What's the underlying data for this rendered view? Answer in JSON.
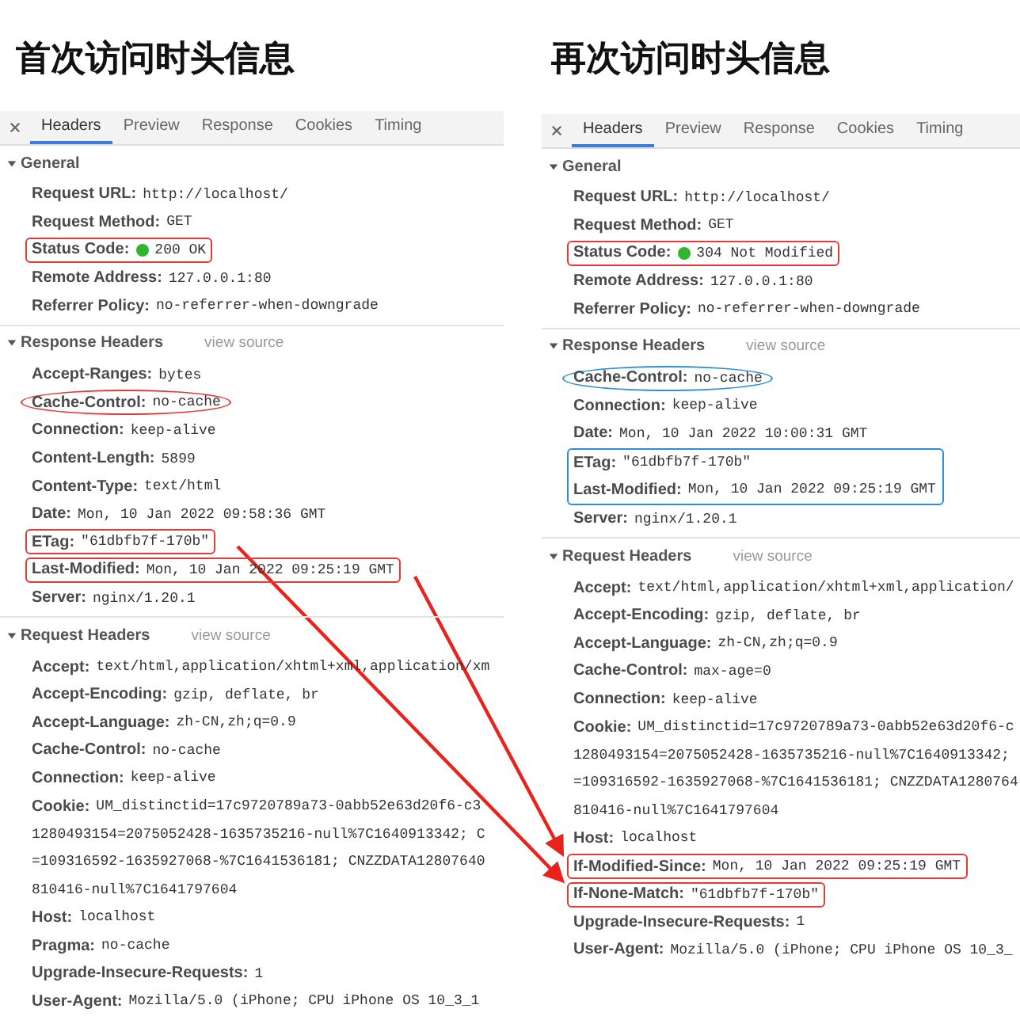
{
  "panels": [
    {
      "title": "首次访问时头信息",
      "tabs": [
        {
          "label": "Headers",
          "selected": true
        },
        {
          "label": "Preview",
          "selected": false
        },
        {
          "label": "Response",
          "selected": false
        },
        {
          "label": "Cookies",
          "selected": false
        },
        {
          "label": "Timing",
          "selected": false
        }
      ],
      "sections": [
        {
          "title": "General",
          "expanded": true,
          "rows": [
            {
              "label": "Request URL:",
              "value": "http://localhost/"
            },
            {
              "label": "Request Method:",
              "value": "GET"
            },
            {
              "label": "Status Code:",
              "value": "200 OK",
              "color": "#2fb52f",
              "mark": {
                "kind": "box",
                "color": "#e53935"
              }
            },
            {
              "label": "Remote Address:",
              "value": "127.0.0.1:80"
            },
            {
              "label": "Referrer Policy:",
              "value": "no-referrer-when-downgrade"
            }
          ]
        },
        {
          "title": "Response Headers",
          "link": "view source",
          "expanded": true,
          "rows": [
            {
              "label": "Accept-Ranges:",
              "value": "bytes"
            },
            {
              "label": "Cache-Control:",
              "value": "no-cache",
              "mark": {
                "kind": "ellipse",
                "color": "#e53935"
              }
            },
            {
              "label": "Connection:",
              "value": "keep-alive"
            },
            {
              "label": "Content-Length:",
              "value": "5899"
            },
            {
              "label": "Content-Type:",
              "value": "text/html"
            },
            {
              "label": "Date:",
              "value": "Mon, 10 Jan 2022 09:58:36 GMT"
            },
            {
              "label": "ETag:",
              "value": "\"61dbfb7f-170b\"",
              "mark": {
                "kind": "box",
                "color": "#e53935"
              }
            },
            {
              "label": "Last-Modified:",
              "value": "Mon, 10 Jan 2022 09:25:19 GMT",
              "mark": {
                "kind": "box",
                "color": "#e53935"
              }
            },
            {
              "label": "Server:",
              "value": "nginx/1.20.1"
            }
          ]
        },
        {
          "title": "Request Headers",
          "link": "view source",
          "expanded": true,
          "rows": [
            {
              "label": "Accept:",
              "value": "text/html,application/xhtml+xml,application/xm"
            },
            {
              "label": "Accept-Encoding:",
              "value": "gzip, deflate, br"
            },
            {
              "label": "Accept-Language:",
              "value": "zh-CN,zh;q=0.9"
            },
            {
              "label": "Cache-Control:",
              "value": "no-cache"
            },
            {
              "label": "Connection:",
              "value": "keep-alive"
            },
            {
              "label": "Cookie:",
              "value": "UM_distinctid=17c9720789a73-0abb52e63d20f6-c3",
              "continuation": [
                "1280493154=2075052428-1635735216-null%7C1640913342; C",
                "=109316592-1635927068-%7C1641536181; CNZZDATA12807640",
                "810416-null%7C1641797604"
              ]
            },
            {
              "label": "Host:",
              "value": "localhost"
            },
            {
              "label": "Pragma:",
              "value": "no-cache"
            },
            {
              "label": "Upgrade-Insecure-Requests:",
              "value": "1"
            },
            {
              "label": "User-Agent:",
              "value": "Mozilla/5.0 (iPhone; CPU iPhone OS 10_3_1"
            }
          ]
        }
      ]
    },
    {
      "title": "再次访问时头信息",
      "tabs": [
        {
          "label": "Headers",
          "selected": true
        },
        {
          "label": "Preview",
          "selected": false
        },
        {
          "label": "Response",
          "selected": false
        },
        {
          "label": "Cookies",
          "selected": false
        },
        {
          "label": "Timing",
          "selected": false
        }
      ],
      "sections": [
        {
          "title": "General",
          "expanded": true,
          "rows": [
            {
              "label": "Request URL:",
              "value": "http://localhost/"
            },
            {
              "label": "Request Method:",
              "value": "GET"
            },
            {
              "label": "Status Code:",
              "value": "304 Not Modified",
              "color": "#2fb52f",
              "mark": {
                "kind": "box",
                "color": "#e53935"
              }
            },
            {
              "label": "Remote Address:",
              "value": "127.0.0.1:80"
            },
            {
              "label": "Referrer Policy:",
              "value": "no-referrer-when-downgrade"
            }
          ]
        },
        {
          "title": "Response Headers",
          "link": "view source",
          "expanded": true,
          "rows": [
            {
              "label": "Cache-Control:",
              "value": "no-cache",
              "mark": {
                "kind": "ellipse",
                "color": "#2a8fd8"
              }
            },
            {
              "label": "Connection:",
              "value": "keep-alive"
            },
            {
              "label": "Date:",
              "value": "Mon, 10 Jan 2022 10:00:31 GMT"
            },
            {
              "kind": "group",
              "mark": {
                "kind": "box",
                "color": "#2a8fd8"
              },
              "rows": [
                {
                  "label": "ETag:",
                  "value": "\"61dbfb7f-170b\""
                },
                {
                  "label": "Last-Modified:",
                  "value": "Mon, 10 Jan 2022 09:25:19 GMT"
                }
              ]
            },
            {
              "label": "Server:",
              "value": "nginx/1.20.1"
            }
          ]
        },
        {
          "title": "Request Headers",
          "link": "view source",
          "expanded": true,
          "rows": [
            {
              "label": "Accept:",
              "value": "text/html,application/xhtml+xml,application/"
            },
            {
              "label": "Accept-Encoding:",
              "value": "gzip, deflate, br"
            },
            {
              "label": "Accept-Language:",
              "value": "zh-CN,zh;q=0.9"
            },
            {
              "label": "Cache-Control:",
              "value": "max-age=0"
            },
            {
              "label": "Connection:",
              "value": "keep-alive"
            },
            {
              "label": "Cookie:",
              "value": "UM_distinctid=17c9720789a73-0abb52e63d20f6-c",
              "continuation": [
                "1280493154=2075052428-1635735216-null%7C1640913342;",
                "=109316592-1635927068-%7C1641536181; CNZZDATA1280764",
                "810416-null%7C1641797604"
              ]
            },
            {
              "label": "Host:",
              "value": "localhost"
            },
            {
              "label": "If-Modified-Since:",
              "value": "Mon, 10 Jan 2022 09:25:19 GMT",
              "mark": {
                "kind": "box",
                "color": "#e53935"
              }
            },
            {
              "label": "If-None-Match:",
              "value": "\"61dbfb7f-170b\"",
              "mark": {
                "kind": "box",
                "color": "#e53935"
              }
            },
            {
              "label": "Upgrade-Insecure-Requests:",
              "value": "1"
            },
            {
              "label": "User-Agent:",
              "value": "Mozilla/5.0 (iPhone; CPU iPhone OS 10_3_"
            }
          ]
        }
      ]
    }
  ]
}
